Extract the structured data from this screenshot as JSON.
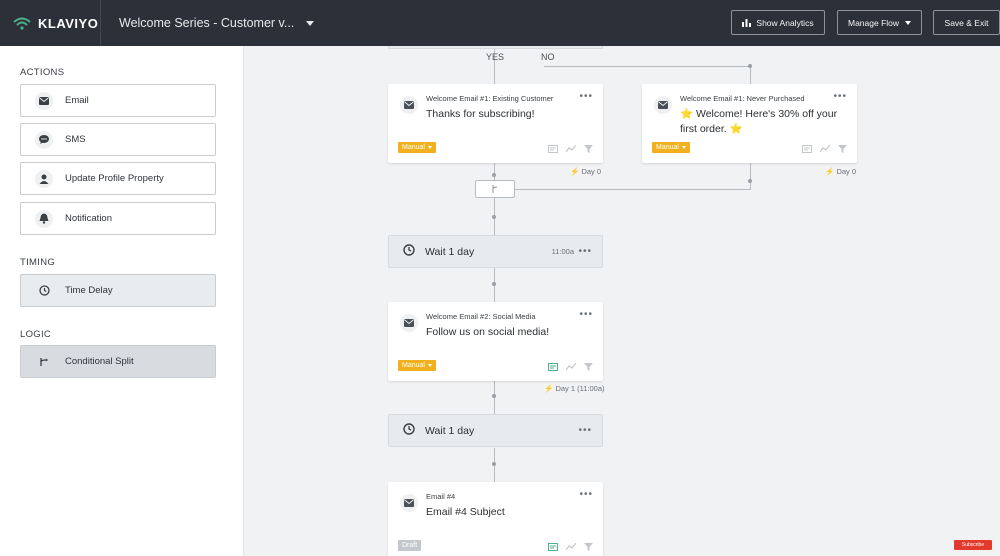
{
  "header": {
    "brand": "KLAVIYO",
    "flow_title": "Welcome Series - Customer v...",
    "show_analytics": "Show Analytics",
    "manage_flow": "Manage Flow",
    "save_exit": "Save & Exit"
  },
  "sidebar": {
    "actions_title": "ACTIONS",
    "actions": [
      {
        "label": "Email",
        "icon": "envelope-icon"
      },
      {
        "label": "SMS",
        "icon": "chat-icon"
      },
      {
        "label": "Update Profile Property",
        "icon": "person-icon"
      },
      {
        "label": "Notification",
        "icon": "bell-icon"
      }
    ],
    "timing_title": "TIMING",
    "timing": [
      {
        "label": "Time Delay",
        "icon": "clock-icon"
      }
    ],
    "logic_title": "LOGIC",
    "logic": [
      {
        "label": "Conditional Split",
        "icon": "split-icon"
      }
    ]
  },
  "canvas": {
    "yes_label": "YES",
    "no_label": "NO",
    "email1": {
      "name": "Welcome Email #1: Existing Customer",
      "subject": "Thanks for subscribing!",
      "tag": "Manual",
      "day": "Day 0"
    },
    "email1b": {
      "name": "Welcome Email #1: Never Purchased",
      "subject": "⭐ Welcome! Here's 30% off your first order. ⭐",
      "tag": "Manual",
      "day": "Day 0"
    },
    "wait1": {
      "label": "Wait 1 day",
      "time": "11:00a"
    },
    "email2": {
      "name": "Welcome Email #2: Social Media",
      "subject": "Follow us on social media!",
      "tag": "Manual",
      "day": "Day 1 (11:00a)"
    },
    "wait2": {
      "label": "Wait 1 day"
    },
    "email4": {
      "name": "Email #4",
      "subject": "Email #4 Subject",
      "tag": "Draft"
    },
    "more": "•••",
    "subscribe_badge": "Subscribe"
  },
  "colors": {
    "topbar": "#2c3038",
    "manual_tag": "#f2b01e",
    "accent_green": "#4cb08a"
  }
}
